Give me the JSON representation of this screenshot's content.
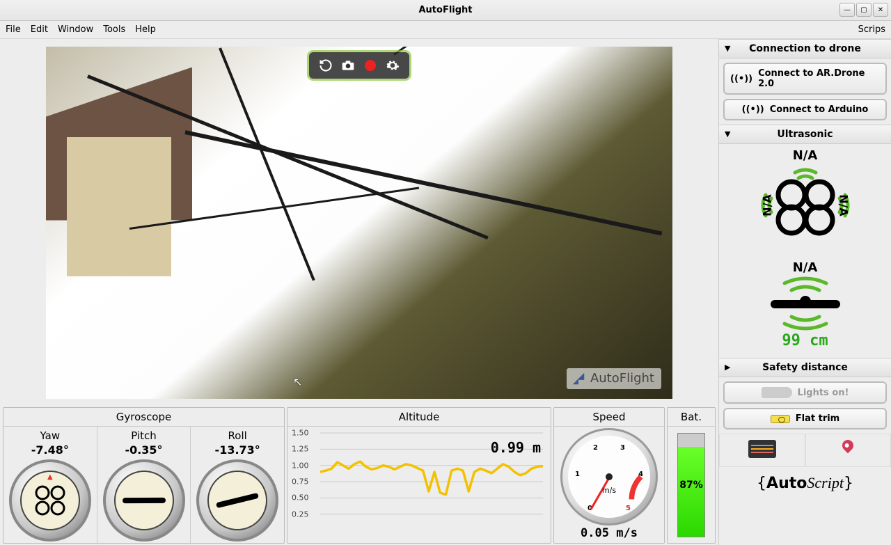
{
  "window": {
    "title": "AutoFlight"
  },
  "menu": {
    "file": "File",
    "edit": "Edit",
    "window": "Window",
    "tools": "Tools",
    "help": "Help",
    "scripts": "Scrips"
  },
  "watermark": "AutoFlight",
  "gyro": {
    "title": "Gyroscope",
    "yaw": {
      "label": "Yaw",
      "value": "-7.48°",
      "deg": -7.48
    },
    "pitch": {
      "label": "Pitch",
      "value": "-0.35°",
      "deg": -0.35
    },
    "roll": {
      "label": "Roll",
      "value": "-13.73°",
      "deg": -13.73
    }
  },
  "altitude": {
    "title": "Altitude",
    "current": "0.99 m",
    "unit": "m"
  },
  "speed": {
    "title": "Speed",
    "unit": "m/s",
    "value": "0.05 m/s",
    "min": 0,
    "max": 5,
    "ticks": [
      "0",
      "1",
      "2",
      "3",
      "4",
      "5"
    ]
  },
  "battery": {
    "title": "Bat.",
    "percent": 87,
    "label": "87%"
  },
  "sidebar": {
    "connection": {
      "title": "Connection to drone",
      "ardrone": "Connect to AR.Drone 2.0",
      "arduino": "Connect to Arduino"
    },
    "ultrasonic": {
      "title": "Ultrasonic",
      "na": "N/A",
      "bottom_value": "99 cm"
    },
    "safety": {
      "title": "Safety distance"
    },
    "lights": "Lights on!",
    "flat_trim": "Flat trim",
    "autoscript": {
      "left": "Auto",
      "right": "Script"
    }
  },
  "chart_data": {
    "type": "line",
    "title": "Altitude",
    "ylabel": "m",
    "ylim": [
      0,
      1.5
    ],
    "yticks": [
      0.25,
      0.5,
      0.75,
      1.0,
      1.25,
      1.5
    ],
    "x": [
      0,
      1,
      2,
      3,
      4,
      5,
      6,
      7,
      8,
      9,
      10,
      11,
      12,
      13,
      14,
      15,
      16,
      17,
      18,
      19,
      20,
      21,
      22,
      23,
      24,
      25,
      26,
      27,
      28,
      29,
      30,
      31,
      32,
      33,
      34,
      35,
      36,
      37,
      38,
      39
    ],
    "values": [
      0.9,
      0.92,
      0.95,
      1.05,
      1.0,
      0.95,
      1.02,
      1.06,
      0.98,
      0.94,
      0.96,
      1.0,
      0.98,
      0.94,
      0.98,
      1.02,
      1.0,
      0.96,
      0.92,
      0.6,
      0.9,
      0.58,
      0.55,
      0.92,
      0.95,
      0.92,
      0.6,
      0.9,
      0.95,
      0.92,
      0.88,
      0.95,
      1.02,
      0.98,
      0.9,
      0.85,
      0.88,
      0.95,
      0.98,
      0.99
    ],
    "current": 0.99
  }
}
